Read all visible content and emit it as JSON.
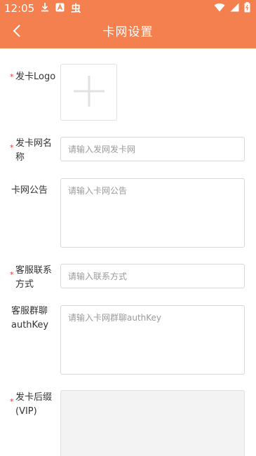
{
  "status_bar": {
    "time": "12:05",
    "icons": [
      "download-icon",
      "a-badge-icon",
      "app-glyph-icon",
      "wifi-icon",
      "signal-icon",
      "battery-icon"
    ],
    "app_glyph": "虫"
  },
  "header": {
    "title": "卡网设置",
    "back_icon": "chevron-left-icon"
  },
  "colors": {
    "accent": "#f47f4f",
    "required": "#e53935",
    "border": "#d8d8d8",
    "placeholder": "#9a9a9a"
  },
  "form": {
    "required_mark": "*",
    "logo": {
      "label": "发卡Logo",
      "required": true,
      "icon": "plus-icon"
    },
    "name": {
      "label": "发卡网名称",
      "required": true,
      "placeholder": "请输入发网发卡网",
      "value": ""
    },
    "notice": {
      "label": "卡网公告",
      "required": false,
      "placeholder": "请输入卡网公告",
      "value": ""
    },
    "contact": {
      "label": "客服联系方式",
      "required": true,
      "placeholder": "请输入联系方式",
      "value": ""
    },
    "authkey": {
      "label": "客服群聊authKey",
      "required": false,
      "placeholder": "请输入卡网群聊authKey",
      "value": ""
    },
    "suffix": {
      "label": "发卡后缀(VIP)",
      "required": true,
      "value": ""
    }
  }
}
